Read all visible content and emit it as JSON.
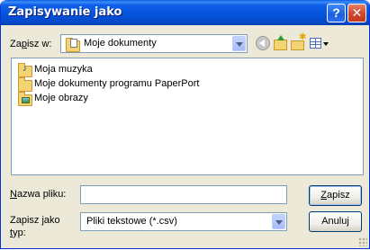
{
  "window": {
    "title": "Zapisywanie jako",
    "help_label": "?",
    "close_label": "✕"
  },
  "toolbar": {
    "save_in_label": "Zapisz w:",
    "save_in_value": "Moje dokumenty",
    "icons": [
      "back-icon",
      "up-folder-icon",
      "new-folder-icon",
      "view-menu-icon"
    ]
  },
  "files": [
    {
      "name": "Moja muzyka",
      "icon": "music-folder-icon"
    },
    {
      "name": "Moje dokumenty programu PaperPort",
      "icon": "folder-icon"
    },
    {
      "name": "Moje obrazy",
      "icon": "pictures-folder-icon"
    }
  ],
  "filename": {
    "label": "Nazwa pliku:",
    "value": ""
  },
  "filetype": {
    "label_line1": "Zapisz jako",
    "label_line2": "typ:",
    "value": "Pliki tekstowe (*.csv)"
  },
  "buttons": {
    "save": "Zapisz",
    "cancel": "Anuluj"
  },
  "colors": {
    "titlebar": "#0553da",
    "dialog_bg": "#ece9d8",
    "close_button": "#d1482a"
  }
}
